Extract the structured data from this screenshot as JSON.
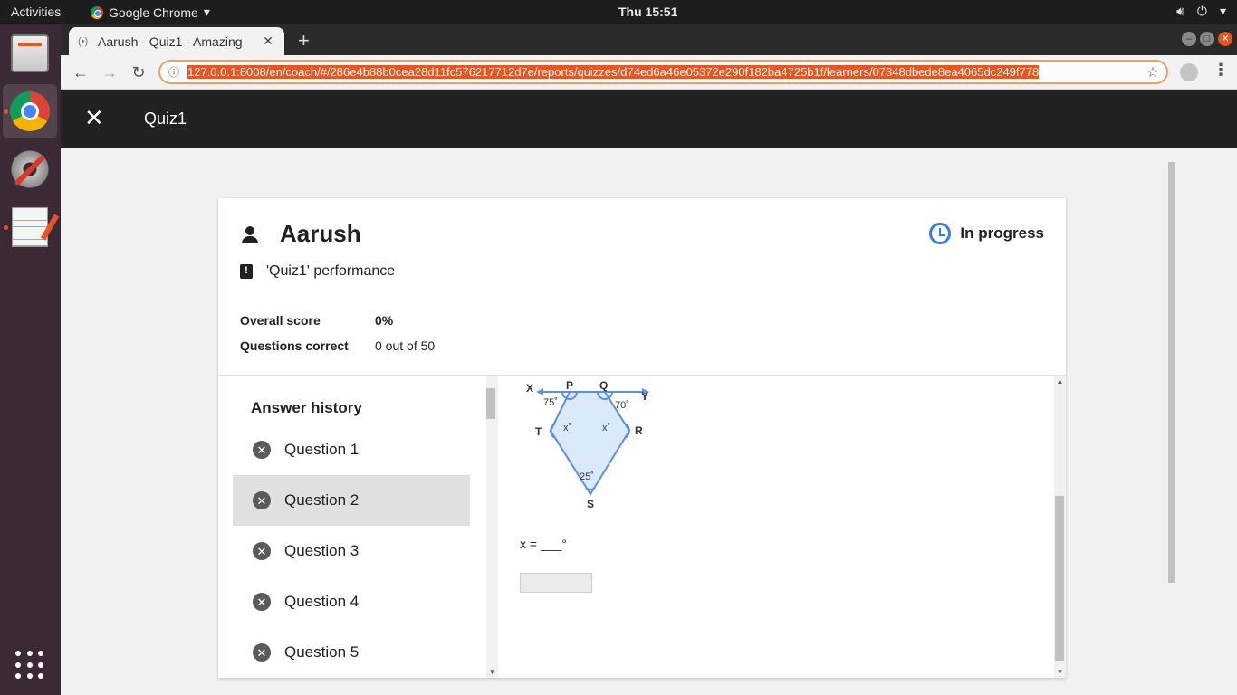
{
  "system": {
    "activities": "Activities",
    "app_name": "Google Chrome",
    "clock": "Thu 15:51"
  },
  "browser": {
    "tab_title": "Aarush - Quiz1 - Amazing",
    "url": "127.0.0.1:8008/en/coach/#/286e4b88b0cea28d11fc576217712d7e/reports/quizzes/d74ed6a46e05372e290f182ba4725b1f/learners/07348dbede8ea4065dc249f778"
  },
  "appbar": {
    "title": "Quiz1"
  },
  "learner": {
    "name": "Aarush",
    "status": "In progress",
    "performance": "'Quiz1' performance"
  },
  "stats": {
    "overall_label": "Overall score",
    "overall_value": "0%",
    "correct_label": "Questions correct",
    "correct_value": "0 out of 50"
  },
  "history": {
    "title": "Answer history",
    "items": [
      {
        "label": "Question 1"
      },
      {
        "label": "Question 2"
      },
      {
        "label": "Question 3"
      },
      {
        "label": "Question 4"
      },
      {
        "label": "Question 5"
      }
    ],
    "selected_index": 1
  },
  "question": {
    "figure_labels": {
      "X": "X",
      "P": "P",
      "Q": "Q",
      "Y": "Y",
      "T": "T",
      "R": "R",
      "S": "S",
      "a75": "75˚",
      "a70": "70˚",
      "a25": "25˚",
      "xl": "x˚",
      "xr": "x˚"
    },
    "equation": "x = ___°"
  },
  "colors": {
    "figure_stroke": "#5b8fe6",
    "figure_fill": "#dbeafb",
    "status_icon": "#3a7fd0"
  }
}
